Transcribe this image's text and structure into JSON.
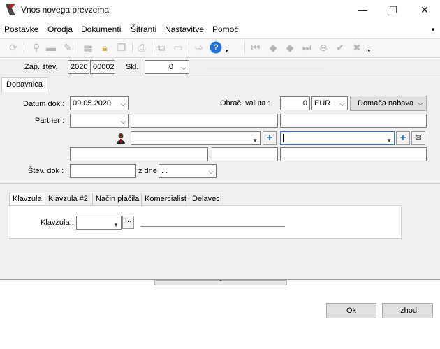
{
  "window": {
    "title": "Vnos novega prevzema",
    "minimize": "—",
    "maximize": "☐",
    "close": "✕"
  },
  "menu": {
    "items": [
      {
        "label": "Postavke"
      },
      {
        "label": "Orodja"
      },
      {
        "label": "Dokumenti"
      },
      {
        "label": "Šifranti"
      },
      {
        "label": "Nastavitve"
      },
      {
        "label": "Pomoč"
      }
    ]
  },
  "toolbar": {
    "icons": [
      "refresh-icon",
      "pin-icon",
      "folder-icon",
      "pen-icon",
      "calculator-icon",
      "lock-icon",
      "copy-window-icon",
      "print-icon",
      "copy-icon",
      "paste-icon",
      "export-icon",
      "help-icon",
      "first-icon",
      "prev-icon",
      "next-icon",
      "last-icon",
      "up-icon",
      "check-icon",
      "cancel-icon"
    ],
    "help_color": "#1f6fd6"
  },
  "header": {
    "zap_label": "Zap. štev.",
    "zap_year": "2020",
    "zap_number": "00002",
    "skl_label": "Skl.",
    "skl_value": "0"
  },
  "tabs": {
    "main": "Dobavnica"
  },
  "form": {
    "datum_label": "Datum dok.:",
    "datum_value": "09.05.2020",
    "obrac_label": "Obrač. valuta :",
    "obrac_value": "0",
    "currency": "EUR",
    "domaca": "Domača nabava",
    "partner_label": "Partner :",
    "stev_label": "Štev. dok :",
    "zdne_label": "z dne",
    "zdne_value": ". ."
  },
  "subtabs": [
    {
      "label": "Klavzula"
    },
    {
      "label": "Klavzula #2"
    },
    {
      "label": "Način plačila"
    },
    {
      "label": "Komercialist"
    },
    {
      "label": "Delavec"
    }
  ],
  "klavzula": {
    "label": "Klavzula :",
    "more": "···"
  },
  "buttons": {
    "ok": "Ok",
    "exit": "Izhod"
  }
}
